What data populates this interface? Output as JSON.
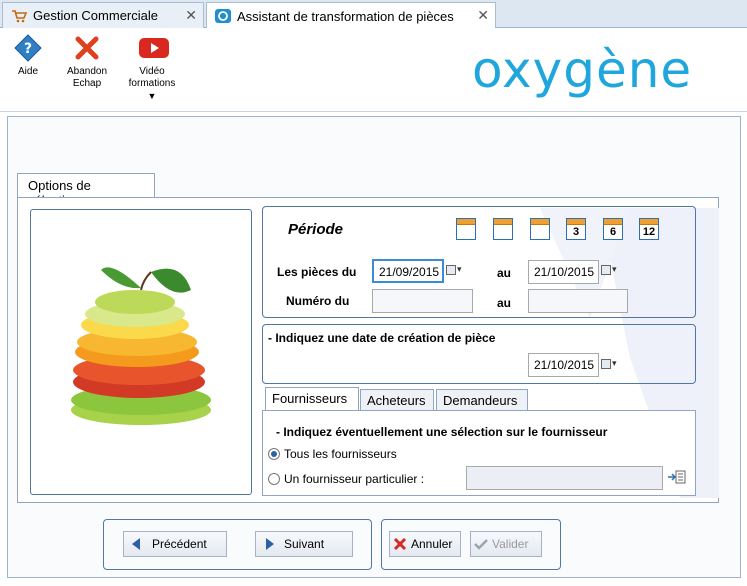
{
  "tabs": [
    {
      "label": "Gestion Commerciale"
    },
    {
      "label": "Assistant de transformation de pièces"
    }
  ],
  "toolbar": {
    "aide": "Aide",
    "abandon_line1": "Abandon",
    "abandon_line2": "Echap",
    "video_line1": "Vidéo",
    "video_line2": "formations"
  },
  "logo": {
    "text": "oxygène",
    "color": "#1fa6dc"
  },
  "options_tab": "Options de sélection",
  "periode": {
    "title": "Période",
    "presets": [
      "",
      "",
      "",
      "3",
      "6",
      "12"
    ],
    "pieces_du_label": "Les pièces du",
    "date_from": "21/09/2015",
    "au_label": "au",
    "date_to": "21/10/2015",
    "numero_label": "Numéro du",
    "numero_from": "",
    "numero_to": ""
  },
  "creation": {
    "title": "- Indiquez une date de création de pièce",
    "date": "21/10/2015"
  },
  "subtabs": [
    "Fournisseurs :",
    "Acheteurs :",
    "Demandeurs :"
  ],
  "fournisseur": {
    "instruction": "- Indiquez éventuellement une sélection sur le fournisseur",
    "option_all": "Tous les fournisseurs",
    "option_one": "Un fournisseur particulier  :",
    "value": ""
  },
  "buttons": {
    "precedent": "Précédent",
    "suivant": "Suivant",
    "annuler": "Annuler",
    "valider": "Valider"
  },
  "colors": {
    "accent": "#5277a6",
    "focus": "#3c8bd9"
  }
}
